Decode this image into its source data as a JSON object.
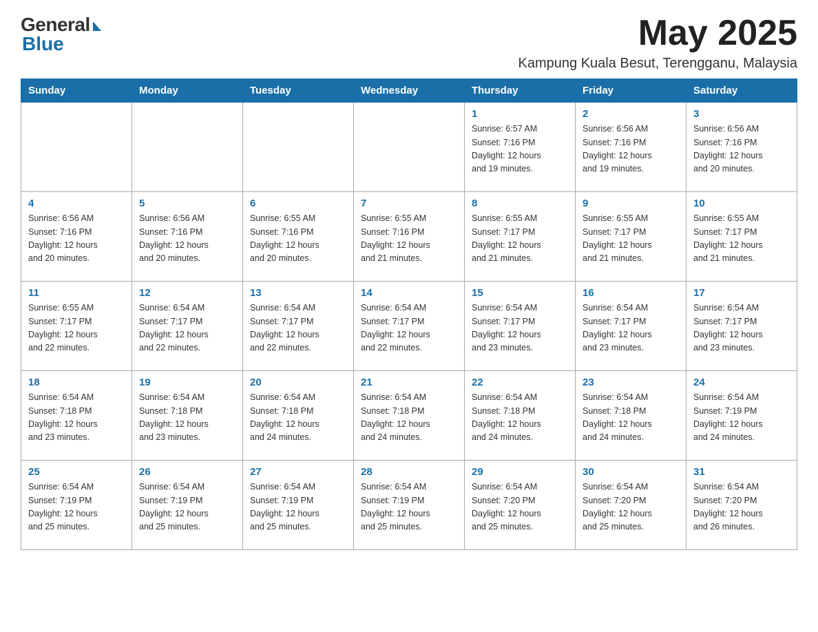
{
  "logo": {
    "general": "General",
    "blue": "Blue"
  },
  "header": {
    "month": "May 2025",
    "location": "Kampung Kuala Besut, Terengganu, Malaysia"
  },
  "weekdays": [
    "Sunday",
    "Monday",
    "Tuesday",
    "Wednesday",
    "Thursday",
    "Friday",
    "Saturday"
  ],
  "weeks": [
    [
      {
        "day": "",
        "info": ""
      },
      {
        "day": "",
        "info": ""
      },
      {
        "day": "",
        "info": ""
      },
      {
        "day": "",
        "info": ""
      },
      {
        "day": "1",
        "info": "Sunrise: 6:57 AM\nSunset: 7:16 PM\nDaylight: 12 hours\nand 19 minutes."
      },
      {
        "day": "2",
        "info": "Sunrise: 6:56 AM\nSunset: 7:16 PM\nDaylight: 12 hours\nand 19 minutes."
      },
      {
        "day": "3",
        "info": "Sunrise: 6:56 AM\nSunset: 7:16 PM\nDaylight: 12 hours\nand 20 minutes."
      }
    ],
    [
      {
        "day": "4",
        "info": "Sunrise: 6:56 AM\nSunset: 7:16 PM\nDaylight: 12 hours\nand 20 minutes."
      },
      {
        "day": "5",
        "info": "Sunrise: 6:56 AM\nSunset: 7:16 PM\nDaylight: 12 hours\nand 20 minutes."
      },
      {
        "day": "6",
        "info": "Sunrise: 6:55 AM\nSunset: 7:16 PM\nDaylight: 12 hours\nand 20 minutes."
      },
      {
        "day": "7",
        "info": "Sunrise: 6:55 AM\nSunset: 7:16 PM\nDaylight: 12 hours\nand 21 minutes."
      },
      {
        "day": "8",
        "info": "Sunrise: 6:55 AM\nSunset: 7:17 PM\nDaylight: 12 hours\nand 21 minutes."
      },
      {
        "day": "9",
        "info": "Sunrise: 6:55 AM\nSunset: 7:17 PM\nDaylight: 12 hours\nand 21 minutes."
      },
      {
        "day": "10",
        "info": "Sunrise: 6:55 AM\nSunset: 7:17 PM\nDaylight: 12 hours\nand 21 minutes."
      }
    ],
    [
      {
        "day": "11",
        "info": "Sunrise: 6:55 AM\nSunset: 7:17 PM\nDaylight: 12 hours\nand 22 minutes."
      },
      {
        "day": "12",
        "info": "Sunrise: 6:54 AM\nSunset: 7:17 PM\nDaylight: 12 hours\nand 22 minutes."
      },
      {
        "day": "13",
        "info": "Sunrise: 6:54 AM\nSunset: 7:17 PM\nDaylight: 12 hours\nand 22 minutes."
      },
      {
        "day": "14",
        "info": "Sunrise: 6:54 AM\nSunset: 7:17 PM\nDaylight: 12 hours\nand 22 minutes."
      },
      {
        "day": "15",
        "info": "Sunrise: 6:54 AM\nSunset: 7:17 PM\nDaylight: 12 hours\nand 23 minutes."
      },
      {
        "day": "16",
        "info": "Sunrise: 6:54 AM\nSunset: 7:17 PM\nDaylight: 12 hours\nand 23 minutes."
      },
      {
        "day": "17",
        "info": "Sunrise: 6:54 AM\nSunset: 7:17 PM\nDaylight: 12 hours\nand 23 minutes."
      }
    ],
    [
      {
        "day": "18",
        "info": "Sunrise: 6:54 AM\nSunset: 7:18 PM\nDaylight: 12 hours\nand 23 minutes."
      },
      {
        "day": "19",
        "info": "Sunrise: 6:54 AM\nSunset: 7:18 PM\nDaylight: 12 hours\nand 23 minutes."
      },
      {
        "day": "20",
        "info": "Sunrise: 6:54 AM\nSunset: 7:18 PM\nDaylight: 12 hours\nand 24 minutes."
      },
      {
        "day": "21",
        "info": "Sunrise: 6:54 AM\nSunset: 7:18 PM\nDaylight: 12 hours\nand 24 minutes."
      },
      {
        "day": "22",
        "info": "Sunrise: 6:54 AM\nSunset: 7:18 PM\nDaylight: 12 hours\nand 24 minutes."
      },
      {
        "day": "23",
        "info": "Sunrise: 6:54 AM\nSunset: 7:18 PM\nDaylight: 12 hours\nand 24 minutes."
      },
      {
        "day": "24",
        "info": "Sunrise: 6:54 AM\nSunset: 7:19 PM\nDaylight: 12 hours\nand 24 minutes."
      }
    ],
    [
      {
        "day": "25",
        "info": "Sunrise: 6:54 AM\nSunset: 7:19 PM\nDaylight: 12 hours\nand 25 minutes."
      },
      {
        "day": "26",
        "info": "Sunrise: 6:54 AM\nSunset: 7:19 PM\nDaylight: 12 hours\nand 25 minutes."
      },
      {
        "day": "27",
        "info": "Sunrise: 6:54 AM\nSunset: 7:19 PM\nDaylight: 12 hours\nand 25 minutes."
      },
      {
        "day": "28",
        "info": "Sunrise: 6:54 AM\nSunset: 7:19 PM\nDaylight: 12 hours\nand 25 minutes."
      },
      {
        "day": "29",
        "info": "Sunrise: 6:54 AM\nSunset: 7:20 PM\nDaylight: 12 hours\nand 25 minutes."
      },
      {
        "day": "30",
        "info": "Sunrise: 6:54 AM\nSunset: 7:20 PM\nDaylight: 12 hours\nand 25 minutes."
      },
      {
        "day": "31",
        "info": "Sunrise: 6:54 AM\nSunset: 7:20 PM\nDaylight: 12 hours\nand 26 minutes."
      }
    ]
  ]
}
